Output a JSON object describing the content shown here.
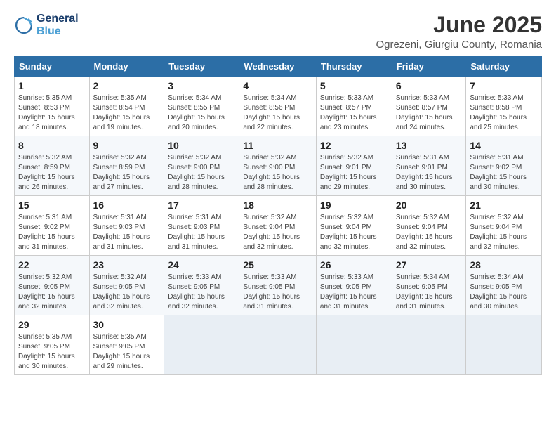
{
  "logo": {
    "line1": "General",
    "line2": "Blue"
  },
  "title": "June 2025",
  "subtitle": "Ogrezeni, Giurgiu County, Romania",
  "weekdays": [
    "Sunday",
    "Monday",
    "Tuesday",
    "Wednesday",
    "Thursday",
    "Friday",
    "Saturday"
  ],
  "weeks": [
    [
      {
        "day": "1",
        "info": "Sunrise: 5:35 AM\nSunset: 8:53 PM\nDaylight: 15 hours\nand 18 minutes."
      },
      {
        "day": "2",
        "info": "Sunrise: 5:35 AM\nSunset: 8:54 PM\nDaylight: 15 hours\nand 19 minutes."
      },
      {
        "day": "3",
        "info": "Sunrise: 5:34 AM\nSunset: 8:55 PM\nDaylight: 15 hours\nand 20 minutes."
      },
      {
        "day": "4",
        "info": "Sunrise: 5:34 AM\nSunset: 8:56 PM\nDaylight: 15 hours\nand 22 minutes."
      },
      {
        "day": "5",
        "info": "Sunrise: 5:33 AM\nSunset: 8:57 PM\nDaylight: 15 hours\nand 23 minutes."
      },
      {
        "day": "6",
        "info": "Sunrise: 5:33 AM\nSunset: 8:57 PM\nDaylight: 15 hours\nand 24 minutes."
      },
      {
        "day": "7",
        "info": "Sunrise: 5:33 AM\nSunset: 8:58 PM\nDaylight: 15 hours\nand 25 minutes."
      }
    ],
    [
      {
        "day": "8",
        "info": "Sunrise: 5:32 AM\nSunset: 8:59 PM\nDaylight: 15 hours\nand 26 minutes."
      },
      {
        "day": "9",
        "info": "Sunrise: 5:32 AM\nSunset: 8:59 PM\nDaylight: 15 hours\nand 27 minutes."
      },
      {
        "day": "10",
        "info": "Sunrise: 5:32 AM\nSunset: 9:00 PM\nDaylight: 15 hours\nand 28 minutes."
      },
      {
        "day": "11",
        "info": "Sunrise: 5:32 AM\nSunset: 9:00 PM\nDaylight: 15 hours\nand 28 minutes."
      },
      {
        "day": "12",
        "info": "Sunrise: 5:32 AM\nSunset: 9:01 PM\nDaylight: 15 hours\nand 29 minutes."
      },
      {
        "day": "13",
        "info": "Sunrise: 5:31 AM\nSunset: 9:01 PM\nDaylight: 15 hours\nand 30 minutes."
      },
      {
        "day": "14",
        "info": "Sunrise: 5:31 AM\nSunset: 9:02 PM\nDaylight: 15 hours\nand 30 minutes."
      }
    ],
    [
      {
        "day": "15",
        "info": "Sunrise: 5:31 AM\nSunset: 9:02 PM\nDaylight: 15 hours\nand 31 minutes."
      },
      {
        "day": "16",
        "info": "Sunrise: 5:31 AM\nSunset: 9:03 PM\nDaylight: 15 hours\nand 31 minutes."
      },
      {
        "day": "17",
        "info": "Sunrise: 5:31 AM\nSunset: 9:03 PM\nDaylight: 15 hours\nand 31 minutes."
      },
      {
        "day": "18",
        "info": "Sunrise: 5:32 AM\nSunset: 9:04 PM\nDaylight: 15 hours\nand 32 minutes."
      },
      {
        "day": "19",
        "info": "Sunrise: 5:32 AM\nSunset: 9:04 PM\nDaylight: 15 hours\nand 32 minutes."
      },
      {
        "day": "20",
        "info": "Sunrise: 5:32 AM\nSunset: 9:04 PM\nDaylight: 15 hours\nand 32 minutes."
      },
      {
        "day": "21",
        "info": "Sunrise: 5:32 AM\nSunset: 9:04 PM\nDaylight: 15 hours\nand 32 minutes."
      }
    ],
    [
      {
        "day": "22",
        "info": "Sunrise: 5:32 AM\nSunset: 9:05 PM\nDaylight: 15 hours\nand 32 minutes."
      },
      {
        "day": "23",
        "info": "Sunrise: 5:32 AM\nSunset: 9:05 PM\nDaylight: 15 hours\nand 32 minutes."
      },
      {
        "day": "24",
        "info": "Sunrise: 5:33 AM\nSunset: 9:05 PM\nDaylight: 15 hours\nand 32 minutes."
      },
      {
        "day": "25",
        "info": "Sunrise: 5:33 AM\nSunset: 9:05 PM\nDaylight: 15 hours\nand 31 minutes."
      },
      {
        "day": "26",
        "info": "Sunrise: 5:33 AM\nSunset: 9:05 PM\nDaylight: 15 hours\nand 31 minutes."
      },
      {
        "day": "27",
        "info": "Sunrise: 5:34 AM\nSunset: 9:05 PM\nDaylight: 15 hours\nand 31 minutes."
      },
      {
        "day": "28",
        "info": "Sunrise: 5:34 AM\nSunset: 9:05 PM\nDaylight: 15 hours\nand 30 minutes."
      }
    ],
    [
      {
        "day": "29",
        "info": "Sunrise: 5:35 AM\nSunset: 9:05 PM\nDaylight: 15 hours\nand 30 minutes."
      },
      {
        "day": "30",
        "info": "Sunrise: 5:35 AM\nSunset: 9:05 PM\nDaylight: 15 hours\nand 29 minutes."
      },
      {
        "day": "",
        "info": ""
      },
      {
        "day": "",
        "info": ""
      },
      {
        "day": "",
        "info": ""
      },
      {
        "day": "",
        "info": ""
      },
      {
        "day": "",
        "info": ""
      }
    ]
  ]
}
